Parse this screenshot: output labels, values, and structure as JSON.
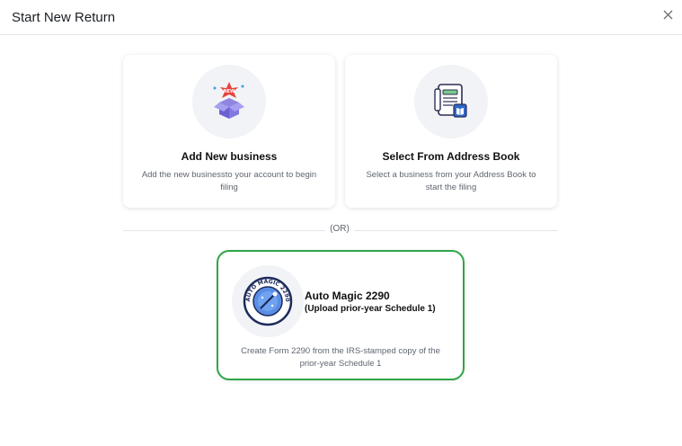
{
  "dialog": {
    "title": "Start New Return"
  },
  "icons": {
    "close": "close-icon"
  },
  "options": [
    {
      "title": "Add New business",
      "description": "Add the new businessto your account to begin filing",
      "icon": "new-box-icon"
    },
    {
      "title": "Select From Address Book",
      "description": "Select a business from your Address Book to start the filing",
      "icon": "address-book-icon"
    }
  ],
  "divider": {
    "label": "(OR)"
  },
  "auto_magic": {
    "badge_text": "AUTO MAGIC 2290",
    "title": "Auto Magic 2290",
    "subtitle": "(Upload prior-year Schedule 1)",
    "description": "Create Form 2290 from the IRS-stamped copy of the prior-year Schedule 1",
    "border_color": "#2ea548"
  }
}
